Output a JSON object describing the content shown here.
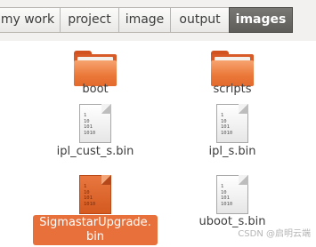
{
  "breadcrumb": [
    "my work",
    "project",
    "image",
    "output",
    "images"
  ],
  "files": [
    {
      "name": "boot",
      "type": "folder-icon"
    },
    {
      "name": "scripts",
      "type": "folder-icon"
    },
    {
      "name": "ipl_cust_s.bin",
      "type": "binary-file-icon"
    },
    {
      "name": "ipl_s.bin",
      "type": "binary-file-icon"
    },
    {
      "name_line1": "SigmastarUpgrade.",
      "name_line2": "bin",
      "type": "binary-file-icon",
      "selected": true
    },
    {
      "name": "uboot_s.bin",
      "type": "binary-file-icon"
    }
  ],
  "binary_glyph": "1\n10\n101\n1010",
  "watermark": "CSDN @启明云端",
  "colors": {
    "selection": "#e8703a",
    "folder": "#ea7738"
  }
}
